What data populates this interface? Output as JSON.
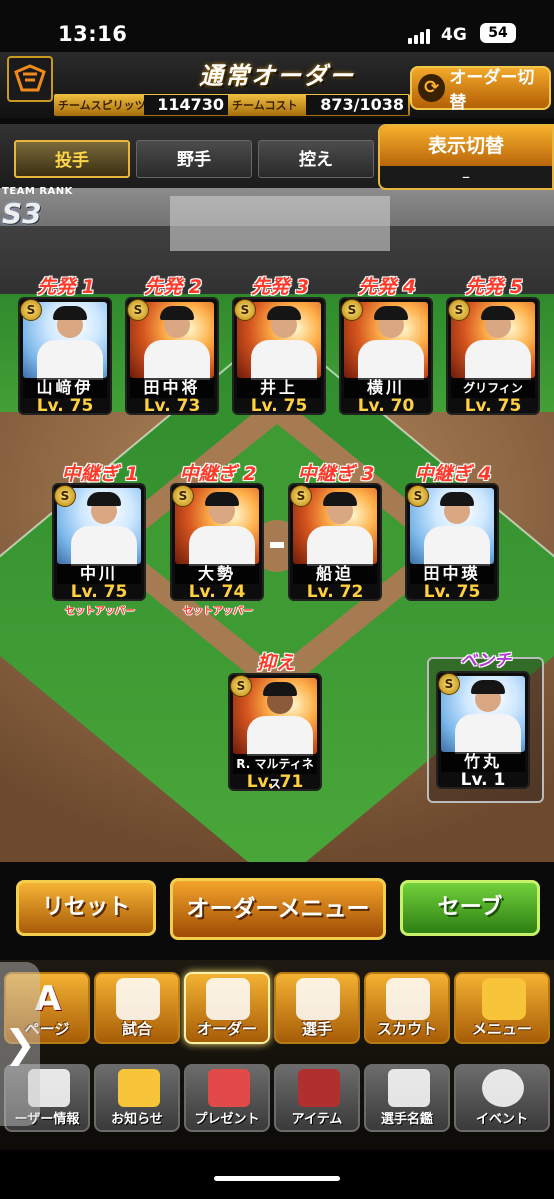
{
  "status_bar": {
    "time": "13:16",
    "network": "4G",
    "battery": "54"
  },
  "header": {
    "title": "通常オーダー",
    "team_spirits_label": "チームスピリッツ",
    "team_spirits_value": "114730",
    "team_cost_label": "チームコスト",
    "team_cost_value": "873/1038",
    "order_switch_label": "オーダー切替",
    "order_switch_icon": "swap-arrows-icon"
  },
  "tabs": [
    {
      "label": "投手",
      "active": true
    },
    {
      "label": "野手",
      "active": false
    },
    {
      "label": "控え",
      "active": false
    }
  ],
  "display_switch": {
    "label": "表示切替",
    "value": "–"
  },
  "team_rank": {
    "label": "TEAM RANK",
    "value": "S3"
  },
  "starters": [
    {
      "slot": "先発 1",
      "name": "山﨑伊",
      "level": "Lv. 75",
      "rank": "S"
    },
    {
      "slot": "先発 2",
      "name": "田中将",
      "level": "Lv. 73",
      "rank": "S"
    },
    {
      "slot": "先発 3",
      "name": "井上",
      "level": "Lv. 75",
      "rank": "S"
    },
    {
      "slot": "先発 4",
      "name": "横川",
      "level": "Lv. 70",
      "rank": "S"
    },
    {
      "slot": "先発 5",
      "name": "グリフィン",
      "level": "Lv. 75",
      "rank": "S"
    }
  ],
  "relievers": [
    {
      "slot": "中継ぎ 1",
      "name": "中川",
      "level": "Lv. 75",
      "rank": "S",
      "sub": "セットアッパー"
    },
    {
      "slot": "中継ぎ 2",
      "name": "大勢",
      "level": "Lv. 74",
      "rank": "S",
      "sub": "セットアッパー"
    },
    {
      "slot": "中継ぎ 3",
      "name": "船迫",
      "level": "Lv. 72",
      "rank": "S",
      "sub": ""
    },
    {
      "slot": "中継ぎ 4",
      "name": "田中瑛",
      "level": "Lv. 75",
      "rank": "S",
      "sub": ""
    }
  ],
  "closer": {
    "slot": "抑え",
    "name": "R. マルティネス",
    "level": "Lv. 71",
    "rank": "S"
  },
  "bench": {
    "slot": "ベンチ",
    "name": "竹丸",
    "level": "Lv. 1",
    "rank": "S"
  },
  "actions": {
    "reset": "リセット",
    "order_menu": "オーダーメニュー",
    "save": "セーブ"
  },
  "nav_top": [
    {
      "label": "ページ",
      "icon": "my-page-icon"
    },
    {
      "label": "試合",
      "icon": "stadium-icon"
    },
    {
      "label": "オーダー",
      "icon": "field-order-icon",
      "active": true
    },
    {
      "label": "選手",
      "icon": "player-icon"
    },
    {
      "label": "スカウト",
      "icon": "scout-card-icon"
    },
    {
      "label": "メニュー",
      "icon": "menu-mascot-icon"
    }
  ],
  "nav_bottom": [
    {
      "label": "ーザー情報",
      "icon": "user-info-icon"
    },
    {
      "label": "お知らせ",
      "icon": "notice-icon"
    },
    {
      "label": "プレゼント",
      "icon": "gift-icon"
    },
    {
      "label": "アイテム",
      "icon": "item-book-icon"
    },
    {
      "label": "選手名鑑",
      "icon": "player-directory-icon"
    },
    {
      "label": "イベント",
      "icon": "event-ball-icon"
    }
  ],
  "side_handle": "❯"
}
